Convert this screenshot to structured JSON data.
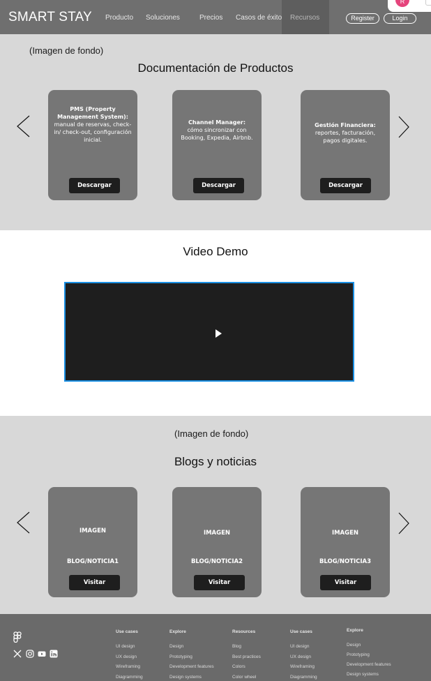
{
  "header": {
    "brand": "SMART STAY",
    "nav": [
      "Producto",
      "Soluciones",
      "Precios",
      "Casos de éxito"
    ],
    "nav_active": "Recursos",
    "register_label": "Register",
    "login_label": "Login"
  },
  "popup": {
    "avatar_initial": "R"
  },
  "docs": {
    "bg_note": "(Imagen de fondo)",
    "title": "Documentación de Productos",
    "cards": [
      {
        "title": "PMS (Property Management System):",
        "body": "manual de reservas, check-in/ check-out, configuración inicial.",
        "button": "Descargar"
      },
      {
        "title": "Channel Manager:",
        "body": "cómo sincronizar con Booking, Expedia, Airbnb.",
        "button": "Descargar"
      },
      {
        "title": "Gestión Financiera:",
        "body": "reportes, facturación, pagos digitales.",
        "button": "Descargar"
      }
    ]
  },
  "video": {
    "title": "Video Demo"
  },
  "blogs": {
    "bg_note": "(Imagen de fondo)",
    "title": "Blogs y noticias",
    "cards": [
      {
        "image": "IMAGEN",
        "label": "BLOG/NOTICIA1",
        "button": "Visitar"
      },
      {
        "image": "IMAGEN",
        "label": "BLOG/NOTICIA2",
        "button": "Visitar"
      },
      {
        "image": "IMAGEN",
        "label": "BLOG/NOTICIA3",
        "button": "Visitar"
      }
    ]
  },
  "footer": {
    "columns": [
      {
        "heading": "Use cases",
        "links": [
          "UI design",
          "UX design",
          "Wireframing",
          "Diagramming"
        ]
      },
      {
        "heading": "Explore",
        "links": [
          "Design",
          "Prototyping",
          "Development features",
          "Design systems"
        ]
      },
      {
        "heading": "Resources",
        "links": [
          "Blog",
          "Best practices",
          "Colors",
          "Color wheel"
        ]
      },
      {
        "heading": "Use cases",
        "links": [
          "UI design",
          "UX design",
          "Wireframing",
          "Diagramming"
        ]
      },
      {
        "heading": "Explore",
        "links": [
          "Design",
          "Prototyping",
          "Development features",
          "Design systems"
        ]
      }
    ],
    "social_icons": [
      "x-icon",
      "instagram-icon",
      "youtube-icon",
      "linkedin-icon"
    ]
  },
  "colors": {
    "header_bg": "#6f6f6f",
    "section_bg": "#d8d8d8",
    "card_bg": "#767676",
    "button_bg": "#1e1e1e",
    "video_border": "#1a8fe3",
    "footer_bg": "#6a6a6a"
  }
}
